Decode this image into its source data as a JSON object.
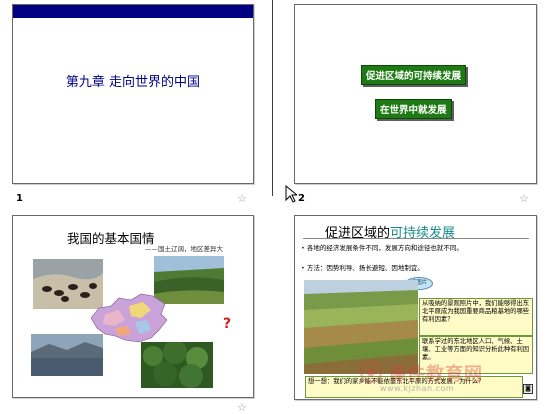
{
  "slides": [
    {
      "number": "1",
      "title": "第九章 走向世界的中国",
      "colors": {
        "bar": "#000080",
        "title": "#000080"
      }
    },
    {
      "number": "2",
      "buttons": [
        "促进区域的可持续发展",
        "在世界中就发展"
      ],
      "colors": {
        "button": "#1e7a14"
      }
    },
    {
      "number": "",
      "title": "我国的基本国情",
      "subtitle": "——国土辽阔，地区差异大",
      "question_mark": "?"
    },
    {
      "number": "",
      "title_prefix": "促进区域的",
      "title_highlight": "可持续发展",
      "bullets": [
        "各地的经济发展条件不同，发展方向和途径也就不同。",
        "方法：因势利导、扬长避短、因地制宜。"
      ],
      "callout": "读图片",
      "box1": "从吸纳的景观照片中，我们能够得出东北平原成为我国重要商品粮基地的哪些有利因素？",
      "box2": "联系学过的东北地区人口、气候、土壤、工业等方面的知识分析此种有利因素。",
      "bottom_note": "想一想：我们的家乡能不能依靠东北平原的方式发展，为什么？",
      "speaker_icon": "speaker-icon"
    }
  ],
  "watermark": {
    "text": "课件教育网",
    "url": "www.kjzhan.com"
  }
}
